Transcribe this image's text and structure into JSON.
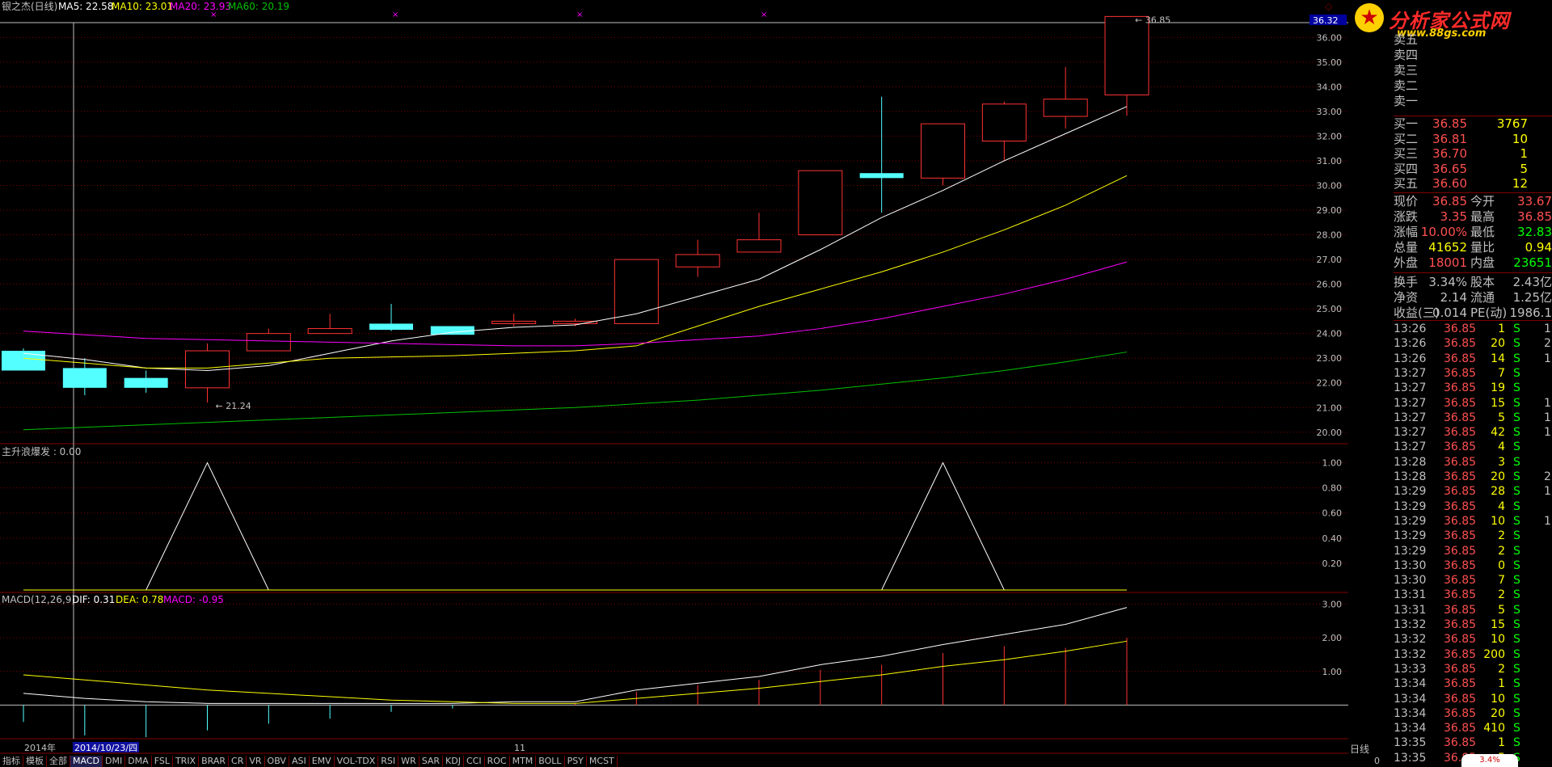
{
  "chart_header": {
    "title": "银之杰(日线)",
    "ma5": "MA5: 22.58",
    "ma10": "MA10: 23.01",
    "ma20": "MA20: 23.93",
    "ma60": "MA60: 20.19",
    "right_price_label": "36.32"
  },
  "colors": {
    "up": "#ff3232",
    "down": "#54ffff",
    "ma5": "#ffffff",
    "ma10": "#ffff00",
    "ma20": "#ff00ff",
    "ma60": "#00c000",
    "grid": "#800000"
  },
  "chart_data": [
    {
      "type": "candlestick",
      "title": "银之杰(日线)",
      "ylim": [
        19.6,
        36.6
      ],
      "yticks": [
        "20.00",
        "21.00",
        "22.00",
        "23.00",
        "24.00",
        "25.00",
        "26.00",
        "27.00",
        "28.00",
        "29.00",
        "30.00",
        "31.00",
        "32.00",
        "33.00",
        "34.00",
        "35.00",
        "36.00"
      ],
      "candles": [
        {
          "o": 23.3,
          "h": 23.4,
          "l": 22.5,
          "c": 22.5
        },
        {
          "o": 22.6,
          "h": 23.0,
          "l": 21.5,
          "c": 21.8
        },
        {
          "o": 22.2,
          "h": 22.5,
          "l": 21.6,
          "c": 21.8
        },
        {
          "o": 21.8,
          "h": 23.6,
          "l": 21.2,
          "c": 23.3
        },
        {
          "o": 23.3,
          "h": 24.2,
          "l": 23.3,
          "c": 24.0
        },
        {
          "o": 24.0,
          "h": 24.8,
          "l": 24.0,
          "c": 24.2
        },
        {
          "o": 24.4,
          "h": 25.2,
          "l": 24.1,
          "c": 24.15
        },
        {
          "o": 24.3,
          "h": 24.3,
          "l": 23.95,
          "c": 23.95
        },
        {
          "o": 24.4,
          "h": 24.8,
          "l": 24.3,
          "c": 24.5
        },
        {
          "o": 24.4,
          "h": 24.6,
          "l": 24.3,
          "c": 24.5
        },
        {
          "o": 24.4,
          "h": 27.0,
          "l": 24.4,
          "c": 27.0
        },
        {
          "o": 26.7,
          "h": 27.8,
          "l": 26.3,
          "c": 27.2
        },
        {
          "o": 27.3,
          "h": 28.9,
          "l": 27.3,
          "c": 27.8
        },
        {
          "o": 28.0,
          "h": 30.6,
          "l": 28.0,
          "c": 30.6
        },
        {
          "o": 30.5,
          "h": 33.6,
          "l": 28.9,
          "c": 30.3
        },
        {
          "o": 30.3,
          "h": 32.5,
          "l": 30.0,
          "c": 32.5
        },
        {
          "o": 31.8,
          "h": 33.4,
          "l": 31.0,
          "c": 33.3
        },
        {
          "o": 32.8,
          "h": 34.8,
          "l": 32.3,
          "c": 33.5
        },
        {
          "o": 33.67,
          "h": 36.85,
          "l": 32.83,
          "c": 36.85
        }
      ],
      "series": [
        {
          "name": "MA5",
          "values": [
            23.2,
            22.95,
            22.6,
            22.5,
            22.7,
            23.2,
            23.7,
            24.05,
            24.25,
            24.35,
            24.8,
            25.5,
            26.2,
            27.4,
            28.7,
            29.8,
            31.0,
            32.1,
            33.2
          ]
        },
        {
          "name": "MA10",
          "values": [
            23.0,
            22.8,
            22.6,
            22.6,
            22.8,
            23.0,
            23.05,
            23.1,
            23.2,
            23.3,
            23.5,
            24.3,
            25.1,
            25.8,
            26.5,
            27.3,
            28.2,
            29.2,
            30.4
          ]
        },
        {
          "name": "MA20",
          "values": [
            24.1,
            23.95,
            23.8,
            23.75,
            23.7,
            23.65,
            23.6,
            23.55,
            23.5,
            23.5,
            23.6,
            23.75,
            23.9,
            24.2,
            24.6,
            25.1,
            25.6,
            26.2,
            26.9
          ]
        },
        {
          "name": "MA60",
          "values": [
            20.1,
            20.2,
            20.3,
            20.4,
            20.5,
            20.6,
            20.7,
            20.8,
            20.9,
            21.0,
            21.15,
            21.3,
            21.5,
            21.7,
            21.95,
            22.2,
            22.5,
            22.85,
            23.25
          ]
        }
      ],
      "annotations": [
        "21.24",
        "36.85"
      ],
      "xlabels": [
        "2014年",
        "2014/10/23/四",
        "11"
      ]
    },
    {
      "type": "line",
      "title": "主升浪爆发 : 0.00",
      "ylim": [
        0,
        1.1
      ],
      "yticks": [
        "0.20",
        "0.40",
        "0.60",
        "0.80",
        "1.00"
      ],
      "series": [
        {
          "name": "主升浪爆发",
          "values": [
            0,
            0,
            0,
            1,
            0,
            0,
            0,
            0,
            0,
            0,
            0,
            0,
            0,
            0,
            0,
            1,
            0,
            0,
            0
          ]
        }
      ]
    },
    {
      "type": "line",
      "title": "MACD(12,26,9)",
      "ylim": [
        -0.95,
        3.3
      ],
      "yticks": [
        "1.00",
        "2.00",
        "3.00"
      ],
      "legend": [
        "DIF: 0.31",
        "DEA: 0.78",
        "MACD: -0.95"
      ],
      "series": [
        {
          "name": "DIF",
          "values": [
            0.35,
            0.2,
            0.1,
            0.05,
            0.05,
            0.05,
            0.05,
            0.05,
            0.1,
            0.1,
            0.45,
            0.65,
            0.85,
            1.2,
            1.45,
            1.8,
            2.1,
            2.4,
            2.9
          ]
        },
        {
          "name": "DEA",
          "values": [
            0.9,
            0.75,
            0.6,
            0.45,
            0.35,
            0.25,
            0.15,
            0.1,
            0.05,
            0.05,
            0.2,
            0.35,
            0.5,
            0.7,
            0.9,
            1.15,
            1.35,
            1.6,
            1.9
          ]
        },
        {
          "name": "MACD",
          "values": [
            -0.5,
            -0.9,
            -0.95,
            -0.75,
            -0.55,
            -0.4,
            -0.2,
            -0.1,
            0.0,
            0.05,
            0.4,
            0.6,
            0.75,
            1.05,
            1.2,
            1.55,
            1.75,
            1.7,
            2.0
          ]
        }
      ]
    }
  ],
  "quote": {
    "asks": [
      [
        "卖五",
        "",
        ""
      ],
      [
        "卖四",
        "",
        ""
      ],
      [
        "卖三",
        "",
        ""
      ],
      [
        "卖二",
        "",
        ""
      ],
      [
        "卖一",
        "",
        ""
      ]
    ],
    "bids": [
      [
        "买一",
        "36.85",
        "3767"
      ],
      [
        "买二",
        "36.81",
        "10"
      ],
      [
        "买三",
        "36.70",
        "1"
      ],
      [
        "买四",
        "36.65",
        "5"
      ],
      [
        "买五",
        "36.60",
        "12"
      ]
    ],
    "stats": [
      [
        "现价",
        "36.85",
        "今开",
        "33.67"
      ],
      [
        "涨跌",
        "3.35",
        "最高",
        "36.85"
      ],
      [
        "涨幅",
        "10.00%",
        "最低",
        "32.83"
      ],
      [
        "总量",
        "41652",
        "量比",
        "0.94"
      ],
      [
        "外盘",
        "18001",
        "内盘",
        "23651"
      ]
    ],
    "fund": [
      [
        "换手",
        "3.34%",
        "股本",
        "2.43亿"
      ],
      [
        "净资",
        "2.14",
        "流通",
        "1.25亿"
      ],
      [
        "收益(三)",
        "0.014",
        "PE(动)",
        "1986.1"
      ]
    ]
  },
  "ticks": [
    [
      "13:26",
      "36.85",
      "1",
      "S",
      "1"
    ],
    [
      "13:26",
      "36.85",
      "20",
      "S",
      "2"
    ],
    [
      "13:26",
      "36.85",
      "14",
      "S",
      "1"
    ],
    [
      "13:27",
      "36.85",
      "7",
      "S",
      ""
    ],
    [
      "13:27",
      "36.85",
      "19",
      "S",
      ""
    ],
    [
      "13:27",
      "36.85",
      "15",
      "S",
      "1"
    ],
    [
      "13:27",
      "36.85",
      "5",
      "S",
      "1"
    ],
    [
      "13:27",
      "36.85",
      "42",
      "S",
      "1"
    ],
    [
      "13:27",
      "36.85",
      "4",
      "S",
      ""
    ],
    [
      "13:28",
      "36.85",
      "3",
      "S",
      ""
    ],
    [
      "13:28",
      "36.85",
      "20",
      "S",
      "2"
    ],
    [
      "13:29",
      "36.85",
      "28",
      "S",
      "1"
    ],
    [
      "13:29",
      "36.85",
      "4",
      "S",
      ""
    ],
    [
      "13:29",
      "36.85",
      "10",
      "S",
      "1"
    ],
    [
      "13:29",
      "36.85",
      "2",
      "S",
      ""
    ],
    [
      "13:29",
      "36.85",
      "2",
      "S",
      ""
    ],
    [
      "13:30",
      "36.85",
      "0",
      "S",
      ""
    ],
    [
      "13:30",
      "36.85",
      "7",
      "S",
      ""
    ],
    [
      "13:31",
      "36.85",
      "2",
      "S",
      ""
    ],
    [
      "13:31",
      "36.85",
      "5",
      "S",
      ""
    ],
    [
      "13:32",
      "36.85",
      "15",
      "S",
      ""
    ],
    [
      "13:32",
      "36.85",
      "10",
      "S",
      ""
    ],
    [
      "13:32",
      "36.85",
      "200",
      "S",
      ""
    ],
    [
      "13:33",
      "36.85",
      "2",
      "S",
      ""
    ],
    [
      "13:34",
      "36.85",
      "1",
      "S",
      ""
    ],
    [
      "13:34",
      "36.85",
      "10",
      "S",
      ""
    ],
    [
      "13:34",
      "36.85",
      "20",
      "S",
      ""
    ],
    [
      "13:34",
      "36.85",
      "410",
      "S",
      ""
    ],
    [
      "13:35",
      "36.85",
      "1",
      "S",
      ""
    ],
    [
      "13:35",
      "36.85",
      "5",
      "S",
      ""
    ]
  ],
  "logo": {
    "text": "分析家公式网",
    "url": "www.88gs.com"
  },
  "tabs": [
    "指标",
    "模板",
    "全部",
    "MACD",
    "DMI",
    "DMA",
    "FSL",
    "TRIX",
    "BRAR",
    "CR",
    "VR",
    "OBV",
    "ASI",
    "EMV",
    "VOL-TDX",
    "RSI",
    "WR",
    "SAR",
    "KDJ",
    "CCI",
    "ROC",
    "MTM",
    "BOLL",
    "PSY",
    "MCST"
  ],
  "period_label": "日线",
  "bottom_right": "0",
  "small_badge": "3.4%"
}
